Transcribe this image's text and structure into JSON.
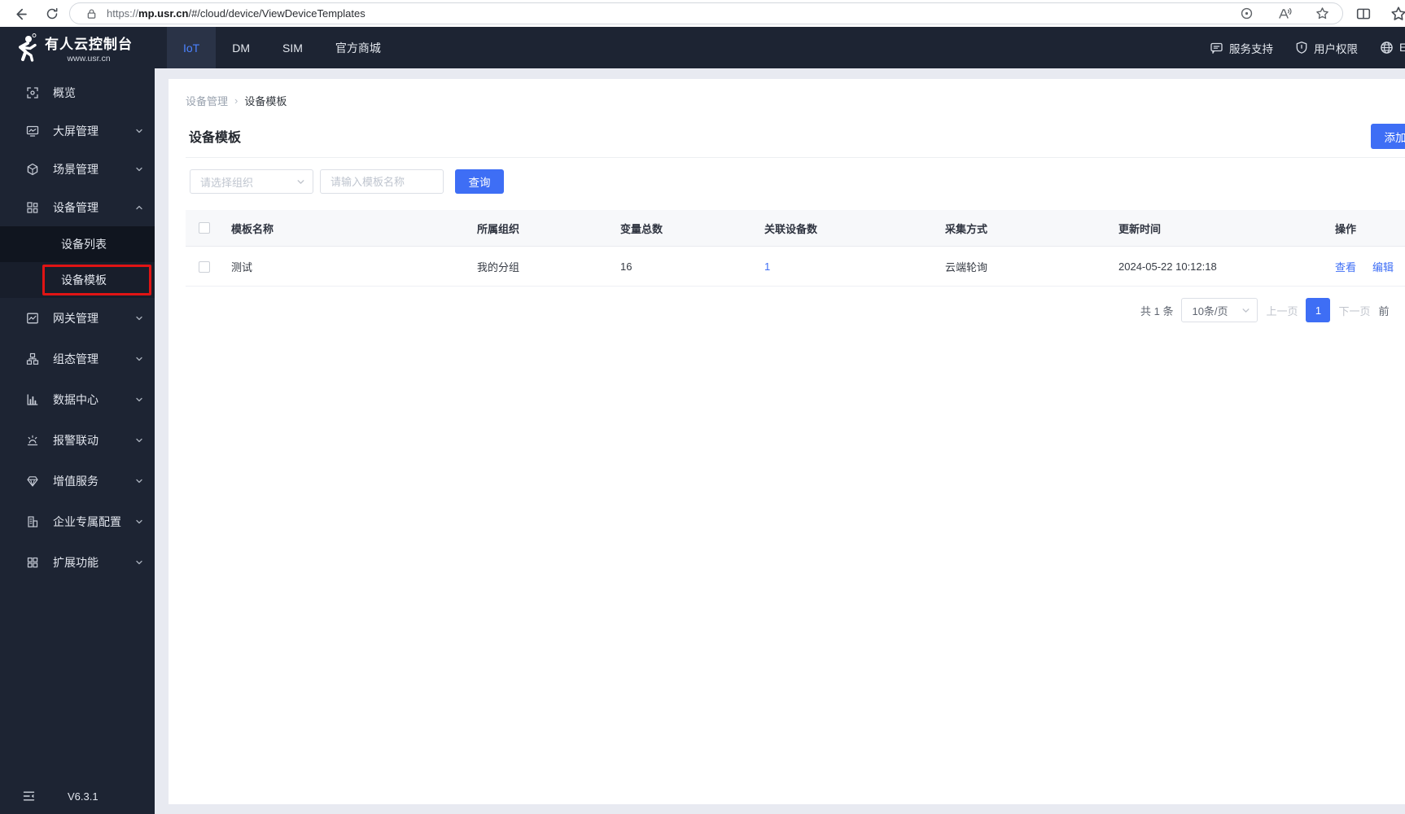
{
  "browser": {
    "url_scheme": "https://",
    "url_domain": "mp.usr.cn",
    "url_path": "/#/cloud/device/ViewDeviceTemplates"
  },
  "header": {
    "logo_title": "有人云控制台",
    "logo_subtitle": "www.usr.cn",
    "tabs": [
      {
        "label": "IoT"
      },
      {
        "label": "DM"
      },
      {
        "label": "SIM"
      },
      {
        "label": "官方商城"
      }
    ],
    "right": {
      "support": "服务支持",
      "permission": "用户权限",
      "language": "English"
    }
  },
  "sidebar": {
    "items": [
      {
        "label": "概览"
      },
      {
        "label": "大屏管理"
      },
      {
        "label": "场景管理"
      },
      {
        "label": "设备管理"
      },
      {
        "label": "网关管理"
      },
      {
        "label": "组态管理"
      },
      {
        "label": "数据中心"
      },
      {
        "label": "报警联动"
      },
      {
        "label": "增值服务"
      },
      {
        "label": "企业专属配置"
      },
      {
        "label": "扩展功能"
      }
    ],
    "submenu": [
      {
        "label": "设备列表"
      },
      {
        "label": "设备模板"
      }
    ],
    "version": "V6.3.1"
  },
  "main": {
    "breadcrumb": {
      "parent": "设备管理",
      "separator": "›",
      "current": "设备模板"
    },
    "title": "设备模板",
    "add_button": "添加",
    "filters": {
      "org_placeholder": "请选择组织",
      "name_placeholder": "请输入模板名称",
      "search_button": "查询"
    },
    "table": {
      "headers": [
        "模板名称",
        "所属组织",
        "变量总数",
        "关联设备数",
        "采集方式",
        "更新时间",
        "操作"
      ],
      "rows": [
        {
          "name": "测试",
          "org": "我的分组",
          "var_total": "16",
          "device_count": "1",
          "collect_method": "云端轮询",
          "updated": "2024-05-22 10:12:18",
          "actions": [
            "查看",
            "编辑"
          ]
        }
      ]
    },
    "pagination": {
      "total": "共 1 条",
      "page_size": "10条/页",
      "prev": "上一页",
      "current": "1",
      "next": "下一页",
      "jump": "前"
    },
    "accent_color": "#3e6ef5",
    "annotation_color": "#e01414"
  }
}
